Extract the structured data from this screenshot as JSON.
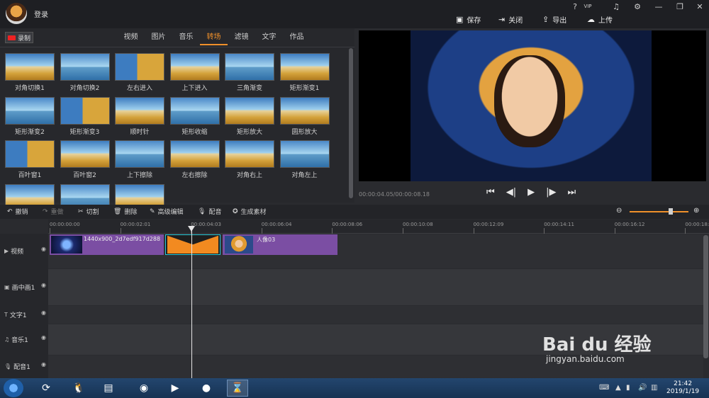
{
  "app": {
    "login": "登录"
  },
  "titlebar": {
    "icons": [
      "?",
      "VIP",
      "♫",
      "⚙",
      "—",
      "❐",
      "✕"
    ],
    "actions": [
      {
        "icon": "save-icon",
        "label": "保存"
      },
      {
        "icon": "close-doc-icon",
        "label": "关闭"
      },
      {
        "icon": "export-icon",
        "label": "导出"
      },
      {
        "icon": "upload-icon",
        "label": "上传"
      }
    ]
  },
  "library": {
    "record_label": "录制",
    "tabs": [
      "视频",
      "图片",
      "音乐",
      "转场",
      "滤镜",
      "文字",
      "作品"
    ],
    "active_tab": "转场",
    "items": [
      "对角切换1",
      "对角切换2",
      "左右进入",
      "上下进入",
      "三角渐变",
      "矩形渐变1",
      "矩形渐变2",
      "矩形渐变3",
      "顺时针",
      "矩形收缩",
      "矩形放大",
      "圆形放大",
      "百叶窗1",
      "百叶窗2",
      "上下擦除",
      "左右擦除",
      "对角右上",
      "对角左上",
      "",
      "",
      ""
    ]
  },
  "preview": {
    "timecode": "00:00:04.05/00:00:08.18"
  },
  "toolbar": {
    "undo": "撤销",
    "redo": "重做",
    "cut": "切割",
    "delete": "删除",
    "advanced_edit": "高级编辑",
    "dub": "配音",
    "generate": "生成素材"
  },
  "timeline": {
    "ticks": [
      "00:00:00:00",
      "00:00:02:01",
      "00:00:04:03",
      "00:00:06:04",
      "00:00:08:06",
      "00:00:10:08",
      "00:00:12:09",
      "00:00:14:11",
      "00:00:16:12",
      "00:00:18:"
    ],
    "tracks": [
      "视频",
      "画中画1",
      "文字1",
      "音乐1",
      "配音1"
    ],
    "clips": {
      "clip1": "1440x900_2d7edf917d288",
      "clip3": "人像03"
    }
  },
  "taskbar": {
    "time": "21:42",
    "date": "2019/1/19"
  },
  "watermark": {
    "brand": "Bai du 经验",
    "url": "jingyan.baidu.com"
  }
}
